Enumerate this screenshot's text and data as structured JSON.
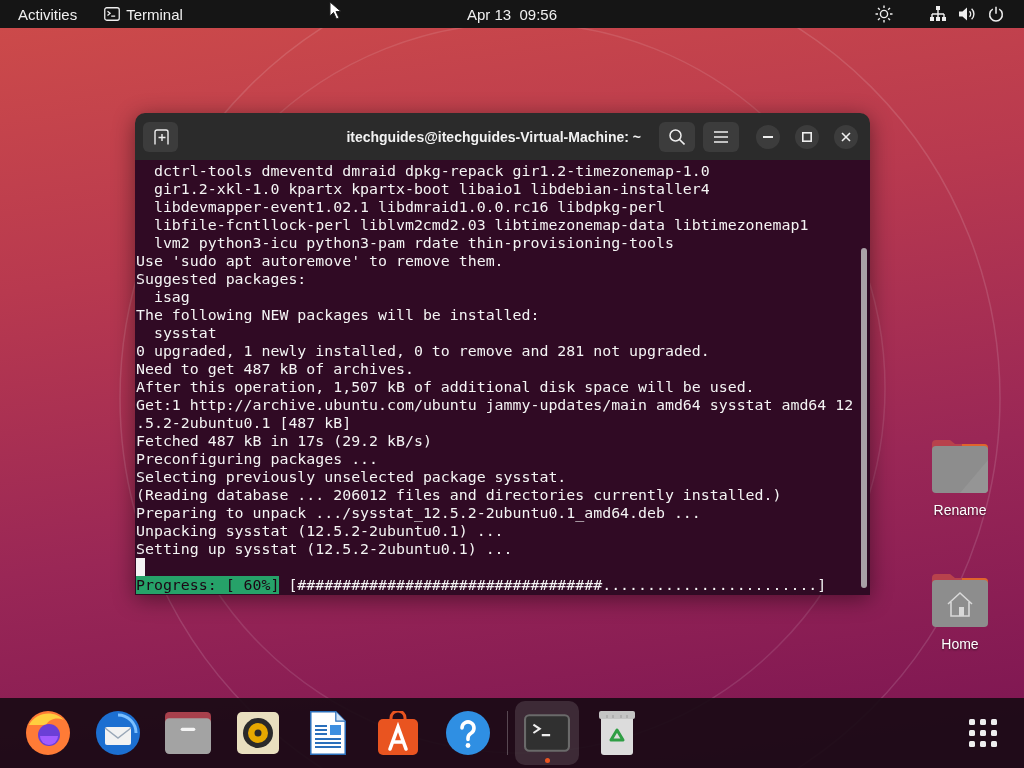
{
  "top_bar": {
    "activities": "Activities",
    "app_menu": "Terminal",
    "clock": "Apr 13  09:56"
  },
  "terminal": {
    "title": "itechguides@itechguides-Virtual-Machine: ~",
    "lines": [
      {
        "kind": "indented",
        "text": "dctrl-tools dmeventd dmraid dpkg-repack gir1.2-timezonemap-1.0"
      },
      {
        "kind": "indented",
        "text": "gir1.2-xkl-1.0 kpartx kpartx-boot libaio1 libdebian-installer4"
      },
      {
        "kind": "indented",
        "text": "libdevmapper-event1.02.1 libdmraid1.0.0.rc16 libdpkg-perl"
      },
      {
        "kind": "indented",
        "text": "libfile-fcntllock-perl liblvm2cmd2.03 libtimezonemap-data libtimezonemap1"
      },
      {
        "kind": "indented",
        "text": "lvm2 python3-icu python3-pam rdate thin-provisioning-tools"
      },
      {
        "kind": "plain",
        "text": "Use 'sudo apt autoremove' to remove them."
      },
      {
        "kind": "plain",
        "text": "Suggested packages:"
      },
      {
        "kind": "indented",
        "text": "isag"
      },
      {
        "kind": "plain",
        "text": "The following NEW packages will be installed:"
      },
      {
        "kind": "indented",
        "text": "sysstat"
      },
      {
        "kind": "plain",
        "text": "0 upgraded, 1 newly installed, 0 to remove and 281 not upgraded."
      },
      {
        "kind": "plain",
        "text": "Need to get 487 kB of archives."
      },
      {
        "kind": "plain",
        "text": "After this operation, 1,507 kB of additional disk space will be used."
      },
      {
        "kind": "plain",
        "text": "Get:1 http://archive.ubuntu.com/ubuntu jammy-updates/main amd64 sysstat amd64 12"
      },
      {
        "kind": "plain",
        "text": ".5.2-2ubuntu0.1 [487 kB]"
      },
      {
        "kind": "plain",
        "text": "Fetched 487 kB in 17s (29.2 kB/s)"
      },
      {
        "kind": "plain",
        "text": "Preconfiguring packages ..."
      },
      {
        "kind": "plain",
        "text": "Selecting previously unselected package sysstat."
      },
      {
        "kind": "plain",
        "text": "(Reading database ... 206012 files and directories currently installed.)"
      },
      {
        "kind": "plain",
        "text": "Preparing to unpack .../sysstat_12.5.2-2ubuntu0.1_amd64.deb ..."
      },
      {
        "kind": "plain",
        "text": "Unpacking sysstat (12.5.2-2ubuntu0.1) ..."
      },
      {
        "kind": "plain",
        "text": "Setting up sysstat (12.5.2-2ubuntu0.1) ..."
      },
      {
        "kind": "cursor"
      },
      {
        "kind": "progress",
        "label": "Progress: [ 60%]",
        "bar": "[##################################........................]"
      }
    ]
  },
  "desktop_icons": [
    {
      "kind": "folder",
      "label": "Rename"
    },
    {
      "kind": "home",
      "label": "Home"
    }
  ],
  "dock": {
    "groups": [
      {
        "items": [
          {
            "kind": "browser",
            "active": false,
            "running": false
          },
          {
            "kind": "mail",
            "active": false,
            "running": false
          },
          {
            "kind": "files",
            "active": false,
            "running": false
          },
          {
            "kind": "music",
            "active": false,
            "running": false
          },
          {
            "kind": "writer",
            "active": false,
            "running": false
          },
          {
            "kind": "store",
            "active": false,
            "running": false
          },
          {
            "kind": "help",
            "active": false,
            "running": false
          }
        ]
      },
      {
        "items": [
          {
            "kind": "terminal",
            "active": true,
            "running": true
          },
          {
            "kind": "trash",
            "active": false,
            "running": false
          }
        ]
      }
    ],
    "show_apps_button": true
  }
}
